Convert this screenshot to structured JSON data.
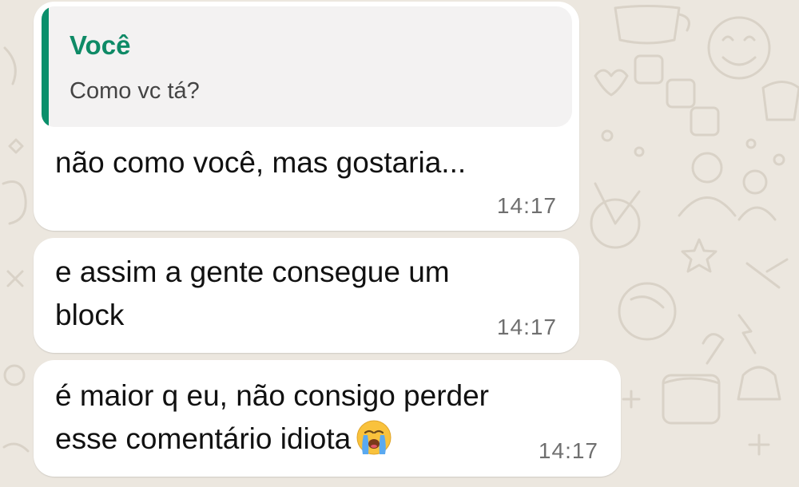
{
  "chat": {
    "wallpaper_color": "#ece7df",
    "bubble_color": "#ffffff",
    "accent_color": "#0e8a66",
    "messages": [
      {
        "quote": {
          "author": "Você",
          "text": "Como vc tá?"
        },
        "text": "não como você, mas gostaria...",
        "time": "14:17"
      },
      {
        "lines": [
          "e assim a gente consegue um",
          "block"
        ],
        "time": "14:17"
      },
      {
        "lines": [
          "é maior q eu, não consigo perder",
          "esse comentário idiota"
        ],
        "emoji": "loudly-crying-face",
        "time": "14:17"
      }
    ]
  }
}
